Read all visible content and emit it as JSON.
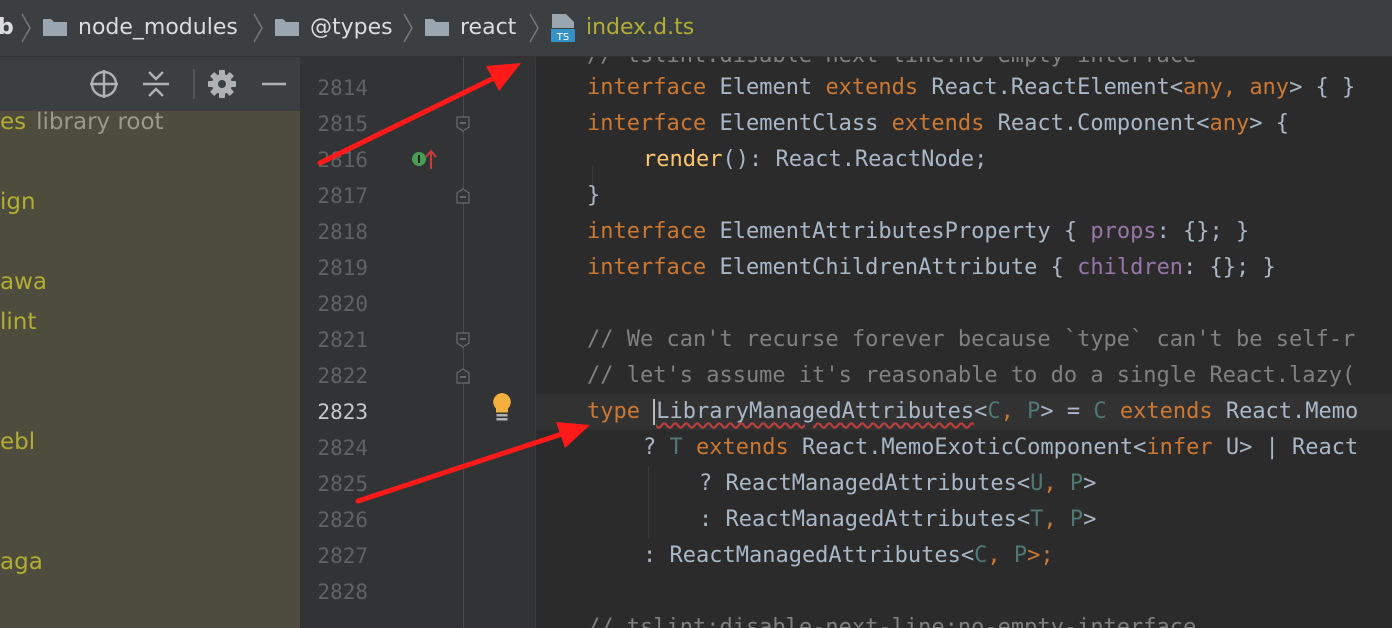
{
  "breadcrumb": {
    "items": [
      {
        "label": "b"
      },
      {
        "label": "node_modules"
      },
      {
        "label": "@types"
      },
      {
        "label": "react"
      },
      {
        "label": "index.d.ts"
      }
    ],
    "ts_badge": "TS"
  },
  "project": {
    "tree": [
      {
        "label": "es",
        "suffix": "library root"
      },
      {
        "label": "ign"
      },
      {
        "label": "awa"
      },
      {
        "label": "lint"
      },
      {
        "label": "ebl"
      },
      {
        "label": "aga"
      }
    ]
  },
  "gutter": {
    "line_numbers": [
      "2814",
      "2815",
      "2816",
      "2817",
      "2818",
      "2819",
      "2820",
      "2821",
      "2822",
      "2823",
      "2824",
      "2825",
      "2826",
      "2827",
      "2828"
    ],
    "current_line": "2823"
  },
  "code": {
    "top_partial": "// tslint:disable-next-line:no-empty-interface",
    "bottom_partial": "// tslint:disable-next-line:no-empty-interface",
    "l2814": {
      "kw1": "interface",
      "name": " Element ",
      "kw2": "extends",
      "rest1": " React.ReactElement<",
      "t1": "any",
      "sep": ", ",
      "t2": "any",
      "rest2": "> { }"
    },
    "l2815": {
      "kw1": "interface",
      "name": " ElementClass ",
      "kw2": "extends",
      "rest1": " React.Component<",
      "t1": "any",
      "rest2": "> {"
    },
    "l2816": {
      "fn": "render",
      "rest": "(): React.ReactNode;"
    },
    "l2817": {
      "text": "}"
    },
    "l2818": {
      "kw1": "interface",
      "name": " ElementAttributesProperty { ",
      "fld": "props",
      "rest": ": {}; }"
    },
    "l2819": {
      "kw1": "interface",
      "name": " ElementChildrenAttribute { ",
      "fld": "children",
      "rest": ": {}; }"
    },
    "l2821": {
      "text": "// We can't recurse forever because `type` can't be self-r"
    },
    "l2822": {
      "text": "// let's assume it's reasonable to do a single React.lazy("
    },
    "l2823": {
      "kw1": "type",
      "name": "LibraryManagedAttributes",
      "lt": "<",
      "tp1": "C",
      "sep": ", ",
      "tp2": "P",
      "mid": "> = ",
      "tp3": "C",
      "sp": " ",
      "kw2": "extends",
      "rest": " React.Memo"
    },
    "l2824": {
      "q": "? ",
      "tp1": "T",
      "sp": " ",
      "kw1": "extends",
      "mid": " React.MemoExoticComponent<",
      "kw2": "infer",
      "rest": " U> | React"
    },
    "l2825": {
      "q": "? ReactManagedAttributes<",
      "tp1": "U",
      "sep": ", ",
      "tp2": "P",
      "rest": ">"
    },
    "l2826": {
      "q": ": ReactManagedAttributes<",
      "tp1": "T",
      "sep": ", ",
      "tp2": "P",
      "rest": ">"
    },
    "l2827": {
      "q": ": ReactManagedAttributes<",
      "tp1": "C",
      "sep": ", ",
      "tp2": "P",
      "rest": ">;"
    }
  },
  "colors": {
    "keyword": "#cc7832",
    "type_param": "#507874",
    "field": "#9876aa",
    "function": "#ffc66d",
    "comment": "#808080",
    "annotation_arrow": "#ff1a1a"
  },
  "icons": [
    "folder-icon",
    "typescript-file-icon",
    "locate-icon",
    "collapse-all-icon",
    "gear-icon",
    "minimize-icon",
    "implemented-method-icon",
    "lightbulb-icon",
    "fold-marker-icon"
  ]
}
